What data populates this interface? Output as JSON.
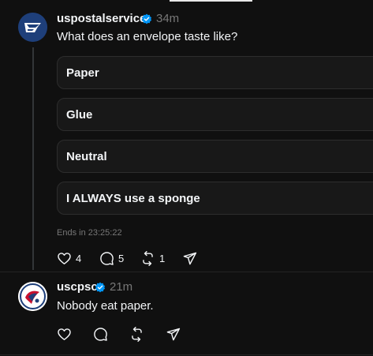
{
  "post1": {
    "username": "uspostalservice",
    "time": "34m",
    "text": "What does an envelope taste like?",
    "poll": {
      "options": [
        "Paper",
        "Glue",
        "Neutral",
        "I ALWAYS use a sponge"
      ],
      "ends": "Ends in 23:25:22"
    },
    "actions": {
      "likes": "4",
      "replies": "5",
      "reposts": "1"
    }
  },
  "post2": {
    "username": "uscpsc",
    "time": "21m",
    "text": "Nobody eat paper."
  },
  "icons": {
    "like": "heart-icon",
    "reply": "comment-icon",
    "repost": "repost-icon",
    "share": "send-icon",
    "verified": "verified-badge-icon"
  },
  "colors": {
    "background": "#101010",
    "verified": "#0095f6",
    "muted": "#777777"
  }
}
